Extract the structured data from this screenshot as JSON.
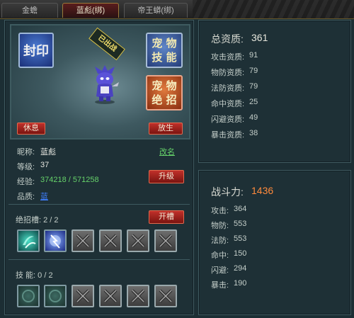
{
  "tabs": [
    {
      "label": "金蟾"
    },
    {
      "label": "蓝彪(绑)"
    },
    {
      "label": "帝王蟒(绑)"
    }
  ],
  "pet": {
    "seal_label": "封印",
    "deployed_badge": "已出战",
    "skill_btn_line1": "宠 物",
    "skill_btn_line2": "技 能",
    "ult_btn_line1": "宠 物",
    "ult_btn_line2": "绝 招",
    "rest_button": "休息",
    "release_button": "放生",
    "nickname_label": "昵称:",
    "nickname": "蓝彪",
    "rename_link": "改名",
    "level_label": "等级:",
    "level": "37",
    "exp_label": "经验:",
    "exp": "374218 / 571258",
    "upgrade_button": "升级",
    "quality_label": "品质:",
    "quality": "蓝",
    "ult_slot_label": "绝招槽: 2 / 2",
    "open_slot_button": "开槽",
    "skill_label": "技  能:  0 / 2"
  },
  "aptitude": {
    "title": "总资质:",
    "total": "361",
    "stats": [
      {
        "label": "攻击资质:",
        "value": "91"
      },
      {
        "label": "物防资质:",
        "value": "79"
      },
      {
        "label": "法防资质:",
        "value": "79"
      },
      {
        "label": "命中资质:",
        "value": "25"
      },
      {
        "label": "闪避资质:",
        "value": "49"
      },
      {
        "label": "暴击资质:",
        "value": "38"
      }
    ]
  },
  "combat": {
    "title": "战斗力:",
    "power": "1436",
    "stats": [
      {
        "label": "攻击:",
        "value": "364"
      },
      {
        "label": "物防:",
        "value": "553"
      },
      {
        "label": "法防:",
        "value": "553"
      },
      {
        "label": "命中:",
        "value": "150"
      },
      {
        "label": "闪避:",
        "value": "294"
      },
      {
        "label": "暴击:",
        "value": "190"
      }
    ]
  },
  "colors": {
    "power_value": "#ff8a3c",
    "aptitude_total": "#e6e6dc",
    "green_text": "#66d26a",
    "link_blue": "#3f7fff"
  }
}
